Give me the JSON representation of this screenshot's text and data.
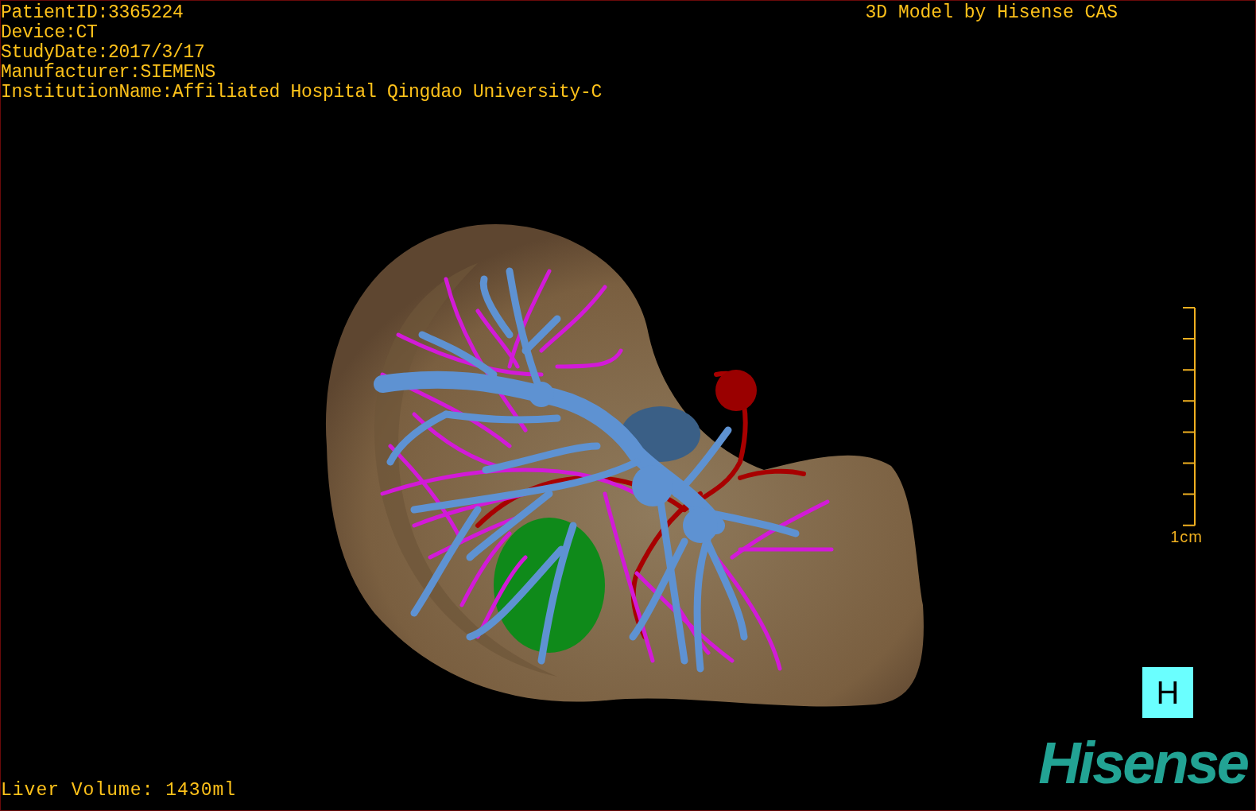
{
  "study_info": [
    "PatientID:3365224",
    "Device:CT",
    "StudyDate:2017/3/17",
    "Manufacturer:SIEMENS",
    "InstitutionName:Affiliated Hospital Qingdao University-C"
  ],
  "model_credit": "3D Model by Hisense CAS",
  "scale_bar": {
    "label": "1cm"
  },
  "view_button": {
    "label": "H"
  },
  "liver_volume": "Liver Volume: 1430ml",
  "logo": {
    "text": "Hisense"
  }
}
